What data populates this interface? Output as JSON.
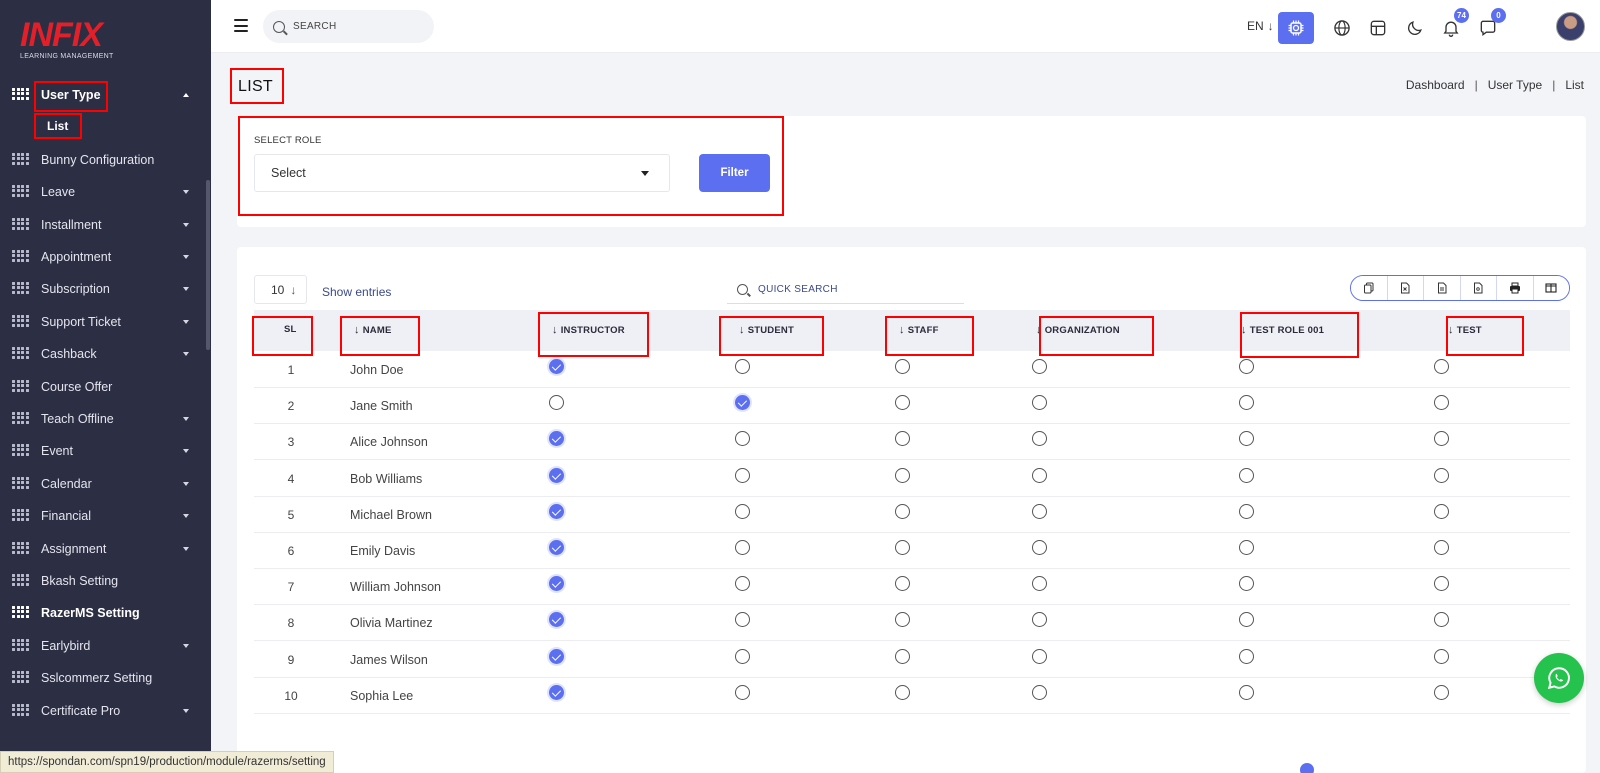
{
  "brand": {
    "logo_text": "INFIX",
    "logo_subtitle": "LEARNING MANAGEMENT"
  },
  "topbar": {
    "search_placeholder": "SEARCH",
    "language": "EN",
    "notifications_count": "74",
    "messages_count": "0",
    "icons": [
      "menu-icon",
      "search-icon",
      "cpu-icon",
      "globe-icon",
      "layout-icon",
      "moon-icon",
      "bell-icon",
      "chat-icon",
      "avatar"
    ]
  },
  "sidebar": {
    "active_parent": "User Type",
    "sub_items": [
      "List"
    ],
    "items": [
      {
        "label": "User Type",
        "caret": "up",
        "active": true
      },
      {
        "label": "Bunny Configuration",
        "caret": "none"
      },
      {
        "label": "Leave",
        "caret": "down"
      },
      {
        "label": "Installment",
        "caret": "down"
      },
      {
        "label": "Appointment",
        "caret": "down"
      },
      {
        "label": "Subscription",
        "caret": "down"
      },
      {
        "label": "Support Ticket",
        "caret": "down"
      },
      {
        "label": "Cashback",
        "caret": "down"
      },
      {
        "label": "Course Offer",
        "caret": "none"
      },
      {
        "label": "Teach Offline",
        "caret": "down"
      },
      {
        "label": "Event",
        "caret": "down"
      },
      {
        "label": "Calendar",
        "caret": "down"
      },
      {
        "label": "Financial",
        "caret": "down"
      },
      {
        "label": "Assignment",
        "caret": "down"
      },
      {
        "label": "Bkash Setting",
        "caret": "none"
      },
      {
        "label": "RazerMS Setting",
        "caret": "none",
        "hover": true
      },
      {
        "label": "Earlybird",
        "caret": "down"
      },
      {
        "label": "Sslcommerz Setting",
        "caret": "none"
      },
      {
        "label": "Certificate Pro",
        "caret": "down"
      }
    ]
  },
  "page": {
    "title": "LIST",
    "breadcrumb": [
      "Dashboard",
      "User Type",
      "List"
    ]
  },
  "filter": {
    "label": "SELECT ROLE",
    "select_value": "Select",
    "button_label": "Filter"
  },
  "table": {
    "entries_value": "10",
    "entries_label": "Show entries",
    "quick_search_placeholder": "QUICK SEARCH",
    "export_buttons": [
      "copy-icon",
      "excel-icon",
      "csv-icon",
      "pdf-icon",
      "print-icon",
      "columns-icon"
    ],
    "columns": [
      "SL",
      "NAME",
      "INSTRUCTOR",
      "STUDENT",
      "STAFF",
      "ORGANIZATION",
      "TEST ROLE 001",
      "TEST"
    ],
    "rows": [
      {
        "sl": "1",
        "name": "John Doe",
        "roles": [
          true,
          false,
          false,
          false,
          false,
          false
        ]
      },
      {
        "sl": "2",
        "name": "Jane Smith",
        "roles": [
          false,
          true,
          false,
          false,
          false,
          false
        ]
      },
      {
        "sl": "3",
        "name": "Alice Johnson",
        "roles": [
          true,
          false,
          false,
          false,
          false,
          false
        ]
      },
      {
        "sl": "4",
        "name": "Bob Williams",
        "roles": [
          true,
          false,
          false,
          false,
          false,
          false
        ]
      },
      {
        "sl": "5",
        "name": "Michael Brown",
        "roles": [
          true,
          false,
          false,
          false,
          false,
          false
        ]
      },
      {
        "sl": "6",
        "name": "Emily Davis",
        "roles": [
          true,
          false,
          false,
          false,
          false,
          false
        ]
      },
      {
        "sl": "7",
        "name": "William Johnson",
        "roles": [
          true,
          false,
          false,
          false,
          false,
          false
        ]
      },
      {
        "sl": "8",
        "name": "Olivia Martinez",
        "roles": [
          true,
          false,
          false,
          false,
          false,
          false
        ]
      },
      {
        "sl": "9",
        "name": "James Wilson",
        "roles": [
          true,
          false,
          false,
          false,
          false,
          false
        ]
      },
      {
        "sl": "10",
        "name": "Sophia Lee",
        "roles": [
          true,
          false,
          false,
          false,
          false,
          false
        ]
      }
    ]
  },
  "status_bar": {
    "url": "https://spondan.com/spn19/production/module/razerms/setting"
  },
  "colors": {
    "accent": "#5b6ff0",
    "sidebar_bg": "#2c2e43",
    "annotation_red": "#ff0000",
    "whatsapp_green": "#25c24d"
  }
}
